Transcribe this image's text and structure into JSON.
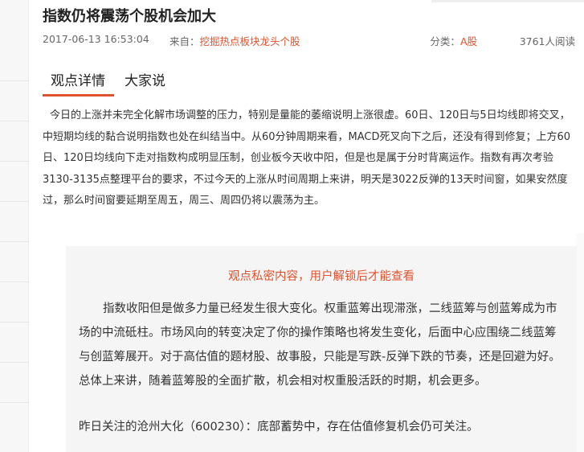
{
  "article": {
    "title": "指数仍将震荡个股机会加大",
    "date": "2017-06-13 16:53:04",
    "from_label": "来自：",
    "source": "挖掘热点板块龙头个股",
    "category_label": "分类：",
    "category": "A股",
    "reads": "3761人阅读"
  },
  "tabs": [
    {
      "label": "观点详情",
      "active": true
    },
    {
      "label": "大家说",
      "active": false
    }
  ],
  "content": {
    "paragraph": "今日的上涨并未完全化解市场调整的压力，特别是量能的萎缩说明上涨很虚。60日、120日与5日均线即将交叉，中短期均线的黏合说明指数也处在纠结当中。从60分钟周期来看，MACD死叉向下之后，还没有得到修复；上方60日、120日均线向下走对指数构成明显压制，创业板今天收中阳，但是也是属于分时背离运作。指数有再次考验3130-3135点整理平台的要求，不过今天的上涨从时间周期上来讲，明天是3022反弹的13天时间窗，如果安然度过，那么时间窗要延期至周五，周三、周四仍将以震荡为主。"
  },
  "locked": {
    "title": "观点私密内容，用户解锁后才能查看",
    "body": "指数收阳但是做多力量已经发生很大变化。权重蓝筹出现滞涨，二线蓝筹与创蓝筹成为市场的中流砥柱。市场风向的转变决定了你的操作策略也将发生变化，后面中心应围绕二线蓝筹与创蓝筹展开。对于高估值的题材股、故事股，只能是写跌-反弹下跌的节奏，还是回避为好。总体上来讲，随着蓝筹股的全面扩散，机会相对权重股活跃的时期，机会更多。",
    "footer": "昨日关注的沧州大化（600230）：底部蓄势中，存在估值修复机会仍可关注。"
  },
  "colors": {
    "accent": "#e0522d",
    "locked_bg": "#f5f5f5",
    "text": "#333333"
  }
}
